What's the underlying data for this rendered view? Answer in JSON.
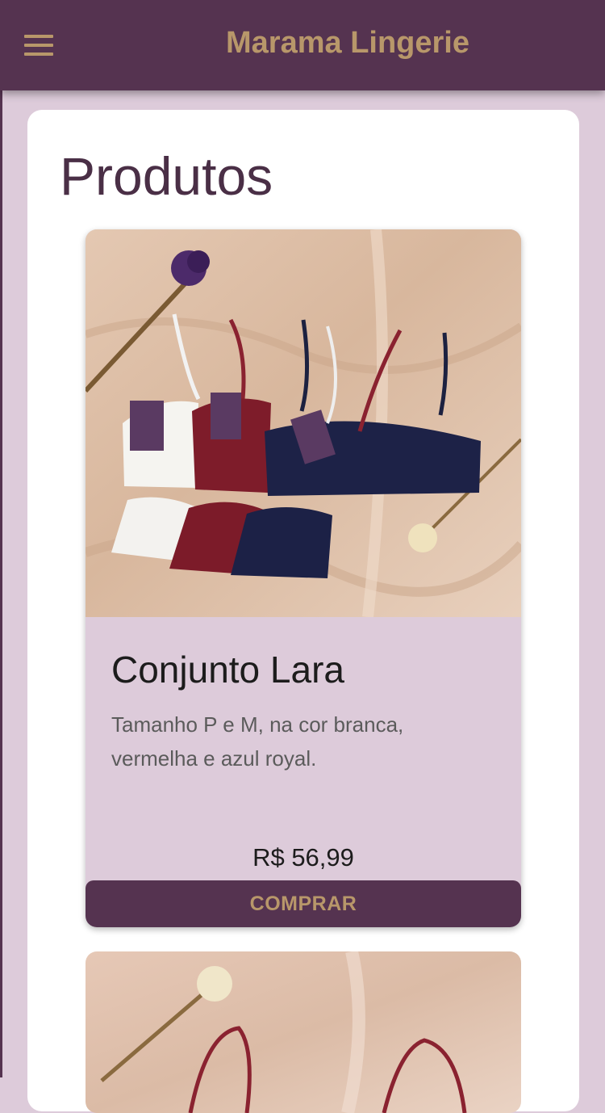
{
  "appbar": {
    "title": "Marama Lingerie",
    "menu_icon": "menu-icon"
  },
  "page": {
    "title": "Produtos"
  },
  "products": [
    {
      "name": "Conjunto Lara",
      "description": "Tamanho P e M, na cor branca, vermelha e azul royal.",
      "price": "R$ 56,99",
      "buy_label": "COMPRAR",
      "photo": "product-photo"
    }
  ],
  "colors": {
    "appbar": "#553350",
    "accent_gold": "#b8976a",
    "background": "#ddcbda",
    "panel": "#ffffff"
  }
}
